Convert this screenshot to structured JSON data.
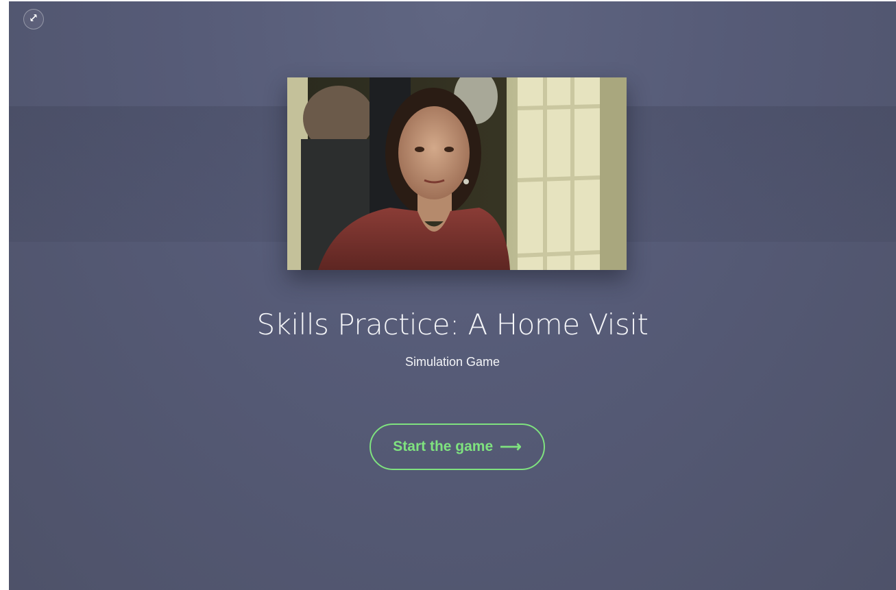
{
  "controls": {
    "fullscreen_icon": "expand-arrows-icon"
  },
  "cover": {
    "image": "woman-in-doorway-photo"
  },
  "game": {
    "title": "Skills Practice: A Home Visit",
    "subtitle": "Simulation Game"
  },
  "start": {
    "label": "Start the game",
    "arrow": "⟶",
    "arrow_icon": "arrow-right-icon"
  },
  "colors": {
    "accent": "#7fe27f",
    "background": "#565b77",
    "text": "#f4f5f8"
  }
}
